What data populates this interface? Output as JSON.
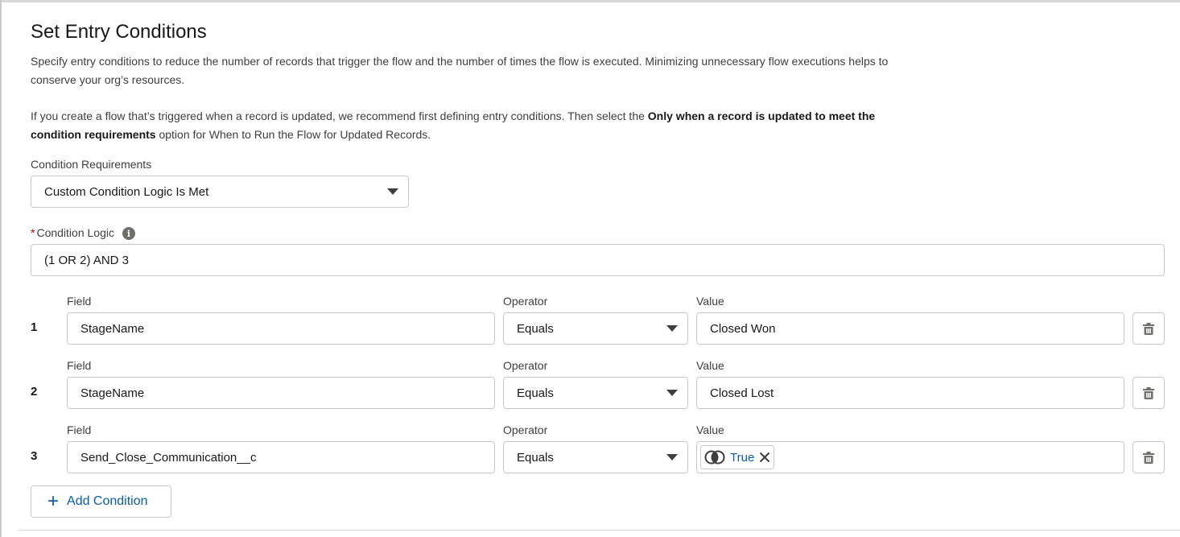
{
  "title": "Set Entry Conditions",
  "intro": {
    "p1": "Specify entry conditions to reduce the number of records that trigger the flow and the number of times the flow is executed. Minimizing unnecessary flow executions helps to conserve your org’s resources.",
    "p2_pre": "If you create a flow that’s triggered when a record is updated, we recommend first defining entry conditions. Then select the ",
    "p2_bold": "Only when a record is updated to meet the condition requirements",
    "p2_post": " option for When to Run the Flow for Updated Records."
  },
  "condition_requirements": {
    "label": "Condition Requirements",
    "value": "Custom Condition Logic Is Met"
  },
  "condition_logic": {
    "required_mark": "*",
    "label": "Condition Logic",
    "value": "(1 OR 2) AND 3"
  },
  "conditions": [
    {
      "num": "1",
      "field_label": "Field",
      "field": "StageName",
      "operator_label": "Operator",
      "operator": "Equals",
      "value_label": "Value",
      "value": "Closed Won"
    },
    {
      "num": "2",
      "field_label": "Field",
      "field": "StageName",
      "operator_label": "Operator",
      "operator": "Equals",
      "value_label": "Value",
      "value": "Closed Lost"
    },
    {
      "num": "3",
      "field_label": "Field",
      "field": "Send_Close_Communication__c",
      "operator_label": "Operator",
      "operator": "Equals",
      "value_label": "Value",
      "value": "True"
    }
  ],
  "add_condition": {
    "icon": "+",
    "label": "Add Condition"
  },
  "colors": {
    "link": "#0b5cab",
    "border": "#c9c9c9",
    "required": "#ba0517"
  },
  "icons": {
    "info": "info-icon",
    "delete": "trash-icon",
    "dropdown": "chevron-down-icon",
    "boolean": "toggle-circles-icon",
    "remove": "close-icon"
  }
}
